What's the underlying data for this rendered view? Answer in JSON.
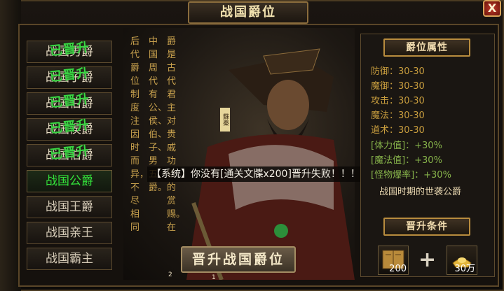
{
  "title": "战国爵位",
  "close_label": "X",
  "ranks": [
    {
      "label": "战国男爵",
      "stamp": "已晋升",
      "state": "done"
    },
    {
      "label": "战国子爵",
      "stamp": "已晋升",
      "state": "done"
    },
    {
      "label": "战国伯爵",
      "stamp": "已晋升",
      "state": "done"
    },
    {
      "label": "战国侯爵",
      "stamp": "已晋升",
      "state": "done"
    },
    {
      "label": "战国伯爵",
      "stamp": "已晋升",
      "state": "done"
    },
    {
      "label": "战国公爵",
      "stamp": "",
      "state": "active"
    },
    {
      "label": "战国王爵",
      "stamp": "",
      "state": "locked"
    },
    {
      "label": "战国亲王",
      "stamp": "",
      "state": "locked"
    },
    {
      "label": "战国霸主",
      "stamp": "",
      "state": "locked"
    }
  ],
  "description_columns": [
    "爵是古代君主对贵戚功臣的赏赐。在",
    "中国周代有公、侯、伯、子、男五爵。",
    "后代爵位制度注因时而异，不尽相同"
  ],
  "seal_text": "蘇秦",
  "upgrade_button": "晋升战国爵位",
  "tiny_numbers": {
    "left": "2",
    "right": "1"
  },
  "system_message": "【系统】你没有[通关文牒x200]晋升失败！！！",
  "attributes_title": "爵位属性",
  "attributes": [
    {
      "text": "防御：30-30",
      "kind": "base"
    },
    {
      "text": "魔御：30-30",
      "kind": "base"
    },
    {
      "text": "攻击：30-30",
      "kind": "base"
    },
    {
      "text": "魔法：30-30",
      "kind": "base"
    },
    {
      "text": "道术：30-30",
      "kind": "base"
    },
    {
      "text": "[体力值]：+30%",
      "kind": "pct"
    },
    {
      "text": "[魔法值]：+30%",
      "kind": "pct"
    },
    {
      "text": "[怪物爆率]：+30%",
      "kind": "pct"
    }
  ],
  "era_text": "战国时期的世袭公爵",
  "conditions_title": "晋升条件",
  "requirements": [
    {
      "icon": "scroll-book-icon",
      "qty": "200"
    },
    {
      "icon": "gold-ingot-icon",
      "qty": "30万"
    }
  ],
  "plus_sign": "+",
  "colors": {
    "active": "#33e03a",
    "gold": "#c89d3e",
    "percent": "#86b24a"
  }
}
